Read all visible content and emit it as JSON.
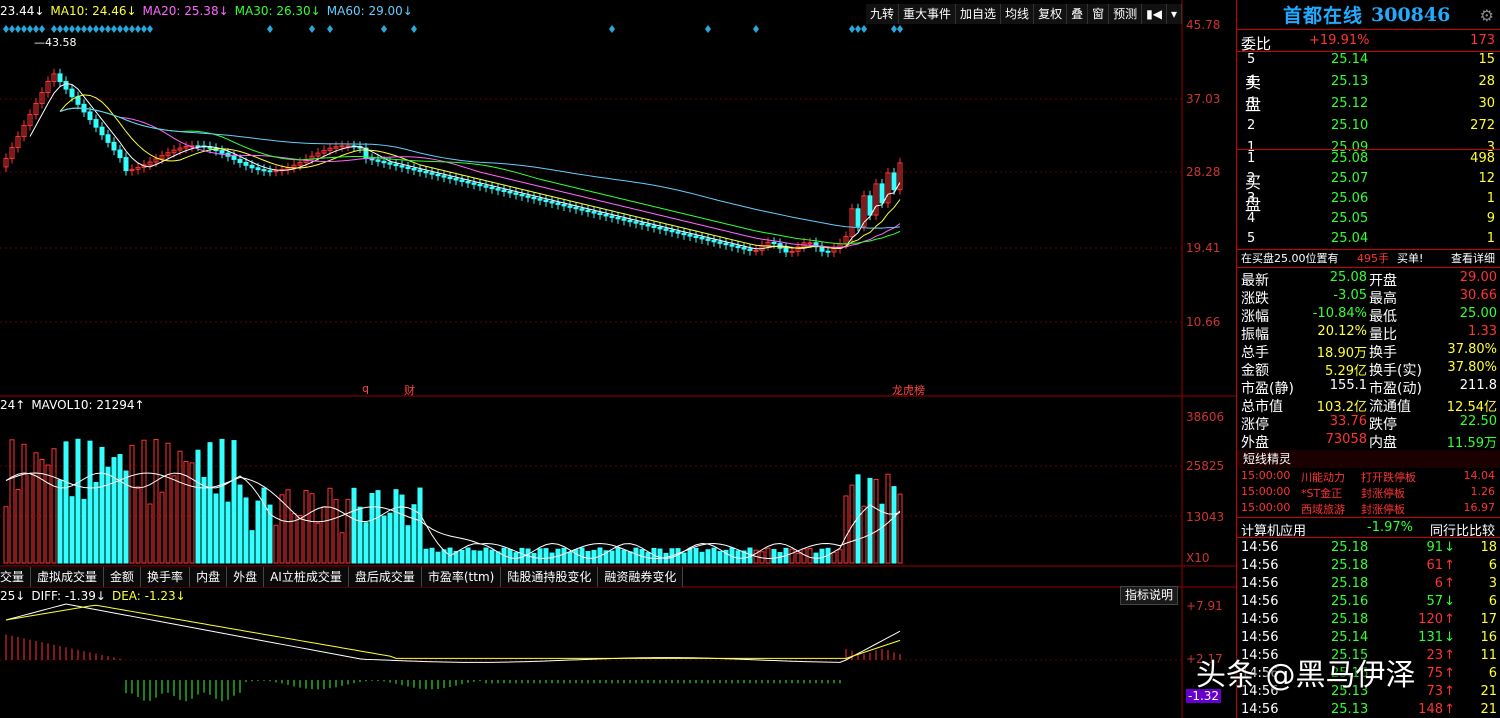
{
  "ma_line": [
    {
      "label": "23.44↓",
      "color": "#ffffff"
    },
    {
      "label": "MA10: 24.46↓",
      "color": "#ffff33"
    },
    {
      "label": "MA20: 25.38↓",
      "color": "#ff66ff"
    },
    {
      "label": "MA30: 26.30↓",
      "color": "#33ff33"
    },
    {
      "label": "MA60: 29.00↓",
      "color": "#66ccff"
    }
  ],
  "toolbar": [
    "九转",
    "重大事件",
    "加自选",
    "均线",
    "复权",
    "叠",
    "窗",
    "预测",
    "▮◀",
    "▾"
  ],
  "price_axis": [
    "45.78",
    "37.03",
    "28.28",
    "19.41",
    "10.66"
  ],
  "high_marker": "43.58",
  "event_markers": [
    "q",
    "财",
    "龙虎榜"
  ],
  "vol_legend": [
    {
      "label": "24↑",
      "color": "#ffffff"
    },
    {
      "label": "MAVOL10: 21294↑",
      "color": "#ffffff"
    }
  ],
  "vol_axis": [
    "38606",
    "25825",
    "13043",
    "X10"
  ],
  "indicator_tabs": [
    "交量",
    "虚拟成交量",
    "金额",
    "换手率",
    "内盘",
    "外盘",
    "AI立桩成交量",
    "盘后成交量",
    "市盈率(ttm)",
    "陆股通持股变化",
    "融资融券变化"
  ],
  "macd_legend": [
    {
      "label": "25↓",
      "color": "#ffffff"
    },
    {
      "label": "DIFF: -1.39↓",
      "color": "#ffffff"
    },
    {
      "label": "DEA: -1.23↓",
      "color": "#ffff33"
    }
  ],
  "macd_axis": [
    "+7.91",
    "+2.17",
    "-1.32"
  ],
  "help_label": "指标说明",
  "stock": {
    "name": "首都在线",
    "code": "300846"
  },
  "weibi": {
    "label": "委比",
    "pct": "+19.91%",
    "val": "173"
  },
  "sell_label": "卖盘",
  "buy_label": "买盘",
  "sell": [
    {
      "lvl": "5",
      "price": "25.14",
      "vol": "15"
    },
    {
      "lvl": "4",
      "price": "25.13",
      "vol": "28"
    },
    {
      "lvl": "3",
      "price": "25.12",
      "vol": "30"
    },
    {
      "lvl": "2",
      "price": "25.10",
      "vol": "272"
    },
    {
      "lvl": "1",
      "price": "25.09",
      "vol": "3"
    }
  ],
  "buy": [
    {
      "lvl": "1",
      "price": "25.08",
      "vol": "498"
    },
    {
      "lvl": "2",
      "price": "25.07",
      "vol": "12"
    },
    {
      "lvl": "3",
      "price": "25.06",
      "vol": "1"
    },
    {
      "lvl": "4",
      "price": "25.05",
      "vol": "9"
    },
    {
      "lvl": "5",
      "price": "25.04",
      "vol": "1"
    }
  ],
  "order_note": {
    "text": "在买盘25.00位置有",
    "vol": "495手",
    "suffix": "买单!",
    "detail": "查看详细"
  },
  "quote": [
    {
      "l1": "最新",
      "v1": "25.08",
      "c1": "#33ff33",
      "l2": "开盘",
      "v2": "29.00",
      "c2": "#ff3333"
    },
    {
      "l1": "涨跌",
      "v1": "-3.05",
      "c1": "#33ff33",
      "l2": "最高",
      "v2": "30.66",
      "c2": "#ff3333"
    },
    {
      "l1": "涨幅",
      "v1": "-10.84%",
      "c1": "#33ff33",
      "l2": "最低",
      "v2": "25.00",
      "c2": "#33ff33"
    },
    {
      "l1": "振幅",
      "v1": "20.12%",
      "c1": "#ffff33",
      "l2": "量比",
      "v2": "1.33",
      "c2": "#ff3333"
    },
    {
      "l1": "总手",
      "v1": "18.90万",
      "c1": "#ffff33",
      "l2": "换手",
      "v2": "37.80%",
      "c2": "#ffff33"
    },
    {
      "l1": "金额",
      "v1": "5.29亿",
      "c1": "#ffff33",
      "l2": "换手(实)",
      "v2": "37.80%",
      "c2": "#ffff33"
    },
    {
      "l1": "市盈(静)",
      "v1": "155.1",
      "c1": "#ffffff",
      "l2": "市盈(动)",
      "v2": "211.8",
      "c2": "#ffffff"
    },
    {
      "l1": "总市值",
      "v1": "103.2亿",
      "c1": "#ffff33",
      "l2": "流通值",
      "v2": "12.54亿",
      "c2": "#ffff33"
    },
    {
      "l1": "涨停",
      "v1": "33.76",
      "c1": "#ff3333",
      "l2": "跌停",
      "v2": "22.50",
      "c2": "#33ff33"
    },
    {
      "l1": "外盘",
      "v1": "73058",
      "c1": "#ff3333",
      "l2": "内盘",
      "v2": "11.59万",
      "c2": "#33ff33"
    }
  ],
  "spirit_title": "短线精灵",
  "spirit": [
    {
      "time": "15:00:00",
      "name": "川能动力",
      "event": "打开跌停板",
      "val": "14.04"
    },
    {
      "time": "15:00:00",
      "name": "*ST金正",
      "event": "封涨停板",
      "val": "1.26"
    },
    {
      "time": "15:00:00",
      "name": "西域旅游",
      "event": "封涨停板",
      "val": "16.97"
    }
  ],
  "sector": {
    "name": "计算机应用",
    "pct": "-1.97%",
    "compare": "同行比比较"
  },
  "ticks": [
    {
      "t": "14:56",
      "p": "25.18",
      "v": "91",
      "d": "down",
      "n": "18"
    },
    {
      "t": "14:56",
      "p": "25.18",
      "v": "61",
      "d": "up",
      "n": "6"
    },
    {
      "t": "14:56",
      "p": "25.18",
      "v": "6",
      "d": "up",
      "n": "3"
    },
    {
      "t": "14:56",
      "p": "25.16",
      "v": "57",
      "d": "down",
      "n": "6"
    },
    {
      "t": "14:56",
      "p": "25.18",
      "v": "120",
      "d": "up",
      "n": "17"
    },
    {
      "t": "14:56",
      "p": "25.14",
      "v": "131",
      "d": "down",
      "n": "16"
    },
    {
      "t": "14:56",
      "p": "25.15",
      "v": "23",
      "d": "up",
      "n": "11"
    },
    {
      "t": "14:56",
      "p": "25.16",
      "v": "75",
      "d": "up",
      "n": "6"
    },
    {
      "t": "14:56",
      "p": "25.13",
      "v": "73",
      "d": "up",
      "n": "21"
    },
    {
      "t": "14:56",
      "p": "25.13",
      "v": "148",
      "d": "up",
      "n": "21"
    }
  ],
  "watermark": "头条 @黑马伊泽"
}
